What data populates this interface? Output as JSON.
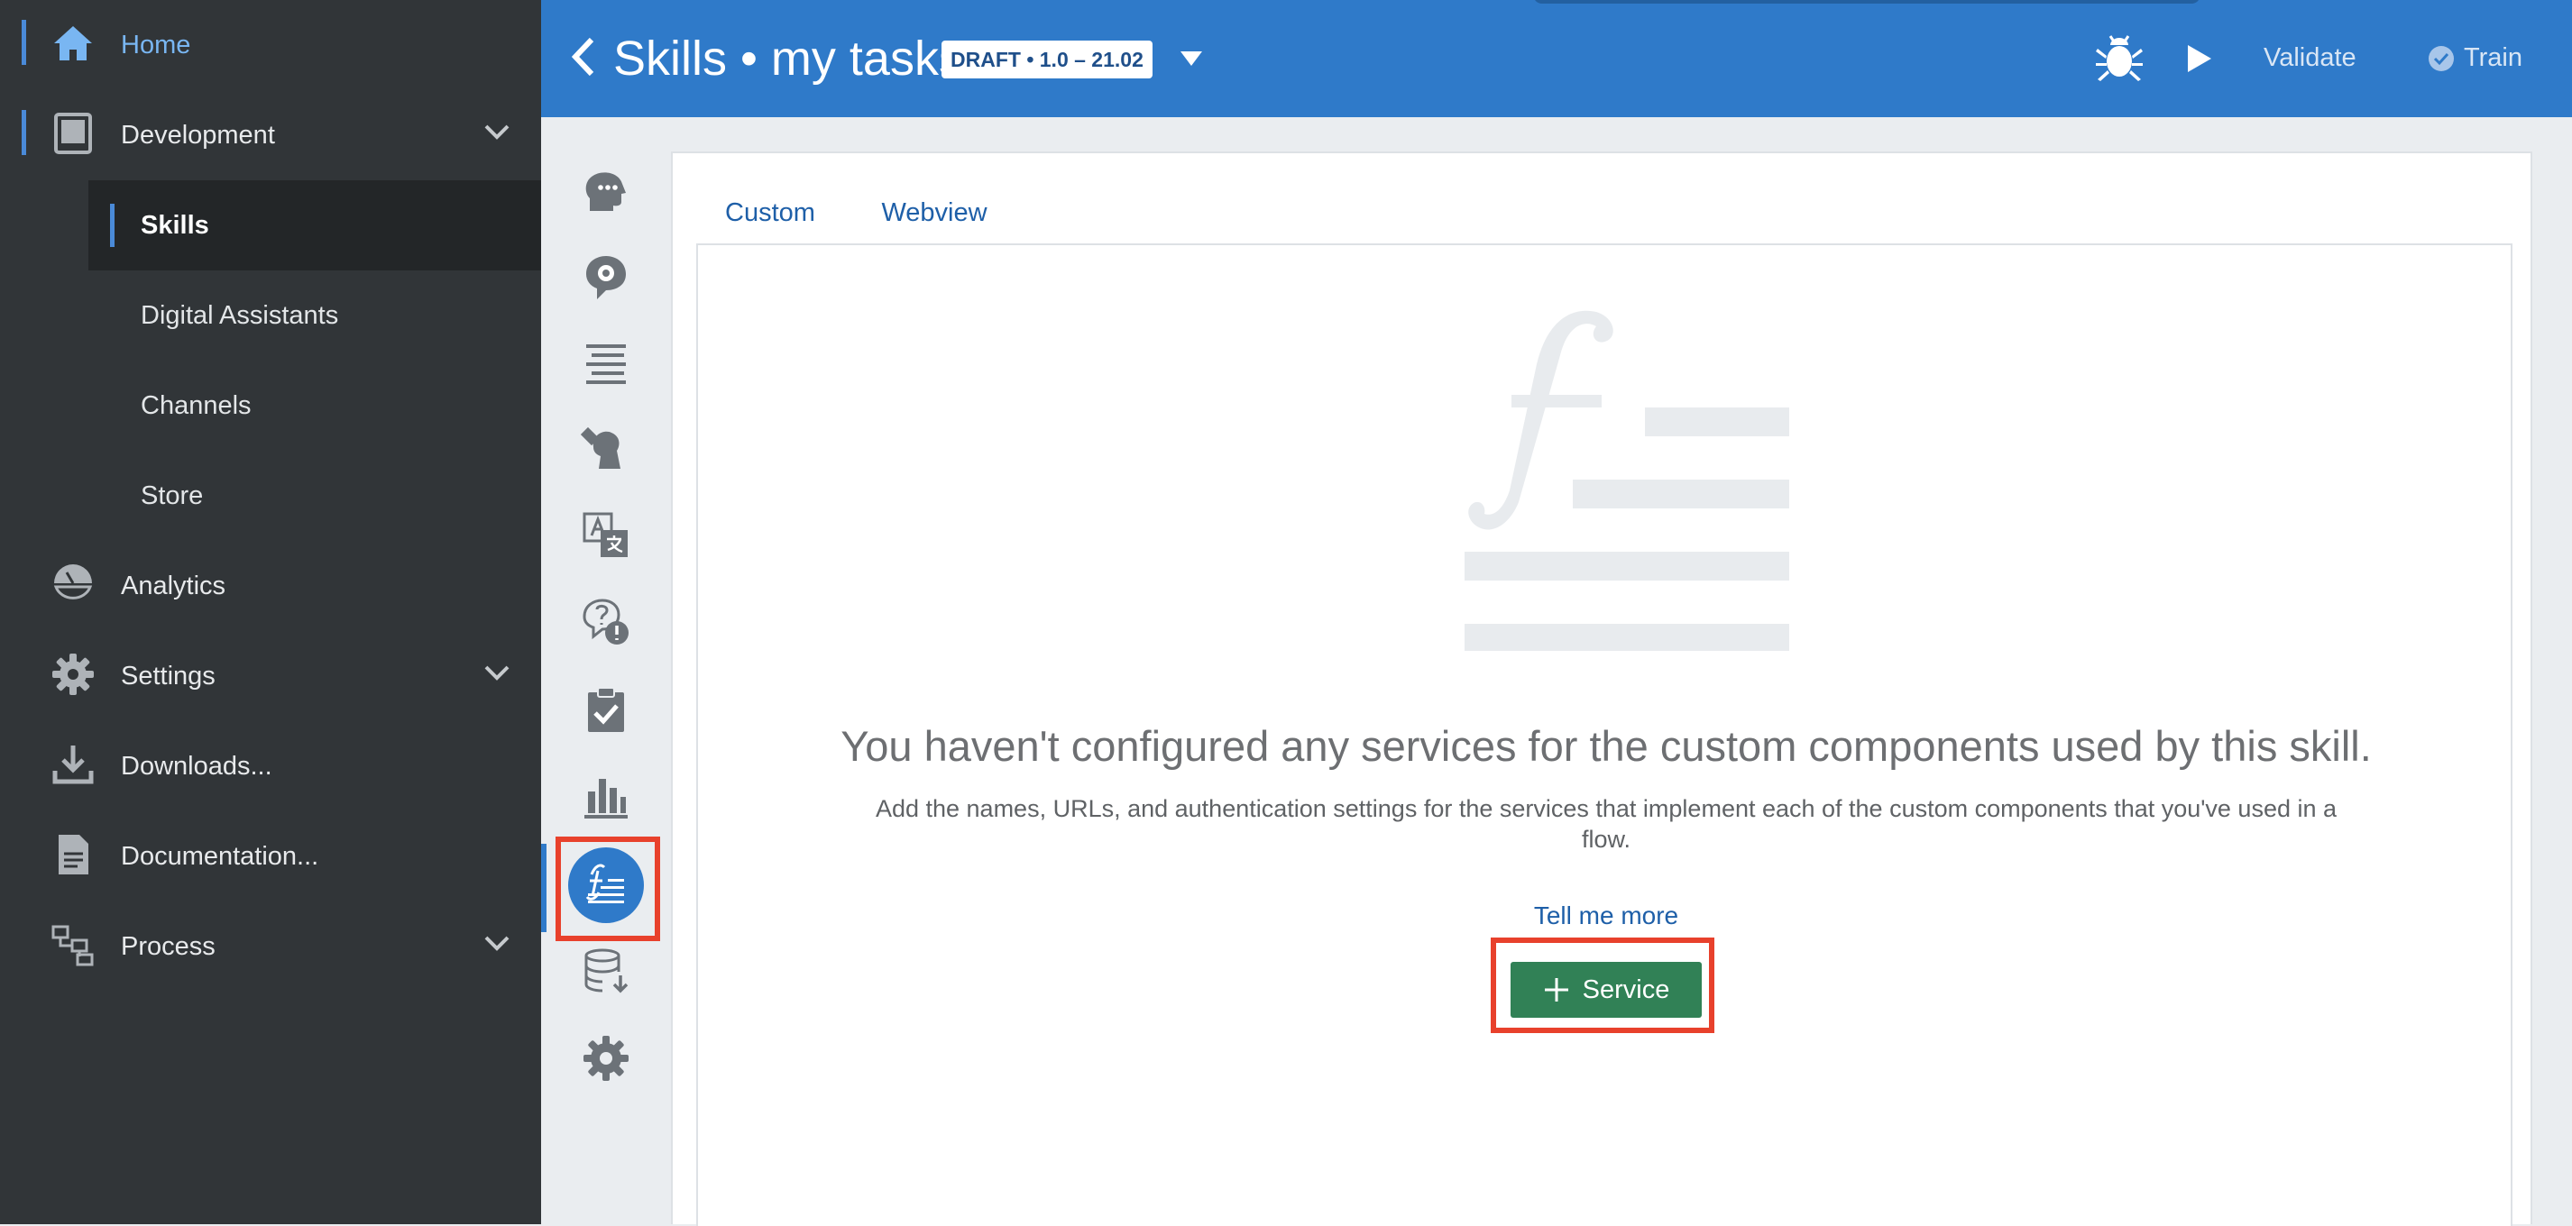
{
  "nav": {
    "items": [
      {
        "label": "Home",
        "icon": "home-icon"
      },
      {
        "label": "Development",
        "icon": "tablet-icon"
      },
      {
        "label": "Analytics",
        "icon": "analytics-icon"
      },
      {
        "label": "Settings",
        "icon": "gear-icon"
      },
      {
        "label": "Downloads...",
        "icon": "download-icon"
      },
      {
        "label": "Documentation...",
        "icon": "document-icon"
      },
      {
        "label": "Process",
        "icon": "process-icon"
      }
    ],
    "development_sub": [
      "Skills",
      "Digital Assistants",
      "Channels",
      "Store"
    ]
  },
  "header": {
    "title": "Skills • my tasks",
    "badge": "DRAFT • 1.0 – 21.02",
    "validate": "Validate",
    "train": "Train"
  },
  "tabs": [
    "Custom",
    "Webview"
  ],
  "empty_state": {
    "heading": "You haven't configured any services for the custom components used by this skill.",
    "description": "Add the names, URLs, and authentication settings for the services that implement each of the custom components that you've used in a flow.",
    "link": "Tell me more",
    "button": "Service"
  },
  "colors": {
    "nav_bg": "#313538",
    "header_bg": "#2f7ac9",
    "accent": "#79b6f2",
    "service_button": "#318156",
    "highlight_box": "#e8412c"
  }
}
